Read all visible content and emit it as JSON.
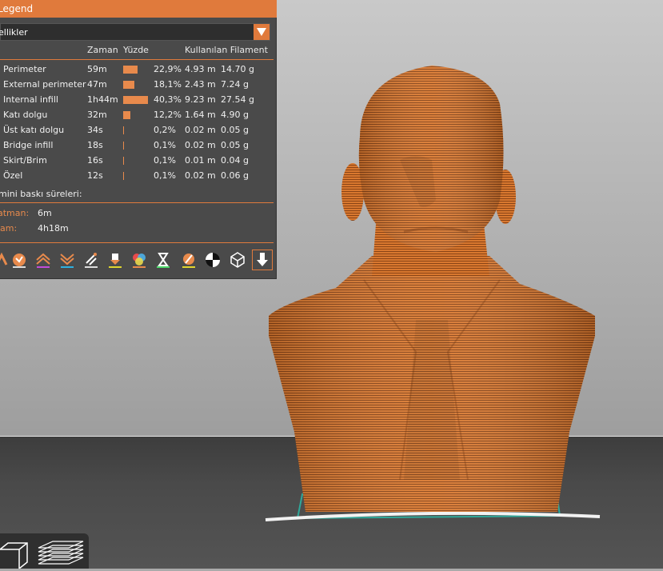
{
  "legend": {
    "title": "Legend",
    "view_select": "ellikler",
    "headers": {
      "zaman": "Zaman",
      "yuzde": "Yüzde",
      "filament": "Kullanılan Filament"
    },
    "rows": [
      {
        "name": "Perimeter",
        "time": "59m",
        "pct": "22,9%",
        "pct_value": 22.9,
        "length": "4.93 m",
        "weight": "14.70 g"
      },
      {
        "name": "External perimeter",
        "time": "47m",
        "pct": "18,1%",
        "pct_value": 18.1,
        "length": "2.43 m",
        "weight": "7.24 g"
      },
      {
        "name": "Internal infill",
        "time": "1h44m",
        "pct": "40,3%",
        "pct_value": 40.3,
        "length": "9.23 m",
        "weight": "27.54 g"
      },
      {
        "name": "Katı dolgu",
        "time": "32m",
        "pct": "12,2%",
        "pct_value": 12.2,
        "length": "1.64 m",
        "weight": "4.90 g"
      },
      {
        "name": "Üst katı dolgu",
        "time": "34s",
        "pct": "0,2%",
        "pct_value": 0.2,
        "length": "0.02 m",
        "weight": "0.05 g"
      },
      {
        "name": "Bridge infill",
        "time": "18s",
        "pct": "0,1%",
        "pct_value": 0.1,
        "length": "0.02 m",
        "weight": "0.05 g"
      },
      {
        "name": "Skirt/Brim",
        "time": "16s",
        "pct": "0,1%",
        "pct_value": 0.1,
        "length": "0.01 m",
        "weight": "0.04 g"
      },
      {
        "name": "Özel",
        "time": "12s",
        "pct": "0,1%",
        "pct_value": 0.1,
        "length": "0.02 m",
        "weight": "0.06 g"
      }
    ],
    "estimate_label": "mini baskı süreleri:",
    "first_layer_label": "atman:",
    "first_layer_value": "6m",
    "total_label": "lam:",
    "total_value": "4h18m"
  },
  "toolbar": {
    "icons": [
      "travel-icon",
      "wipe-icon",
      "retractions-icon",
      "deretractions-icon",
      "seams-icon",
      "tool-changes-icon",
      "color-changes-icon",
      "pause-icon",
      "custom-gcode-icon",
      "center-of-gravity-icon",
      "shells-icon",
      "tool-marker-icon"
    ]
  },
  "colors": {
    "accent": "#e07a3c",
    "panel": "#4a4a4a",
    "model": "#d9762f"
  }
}
